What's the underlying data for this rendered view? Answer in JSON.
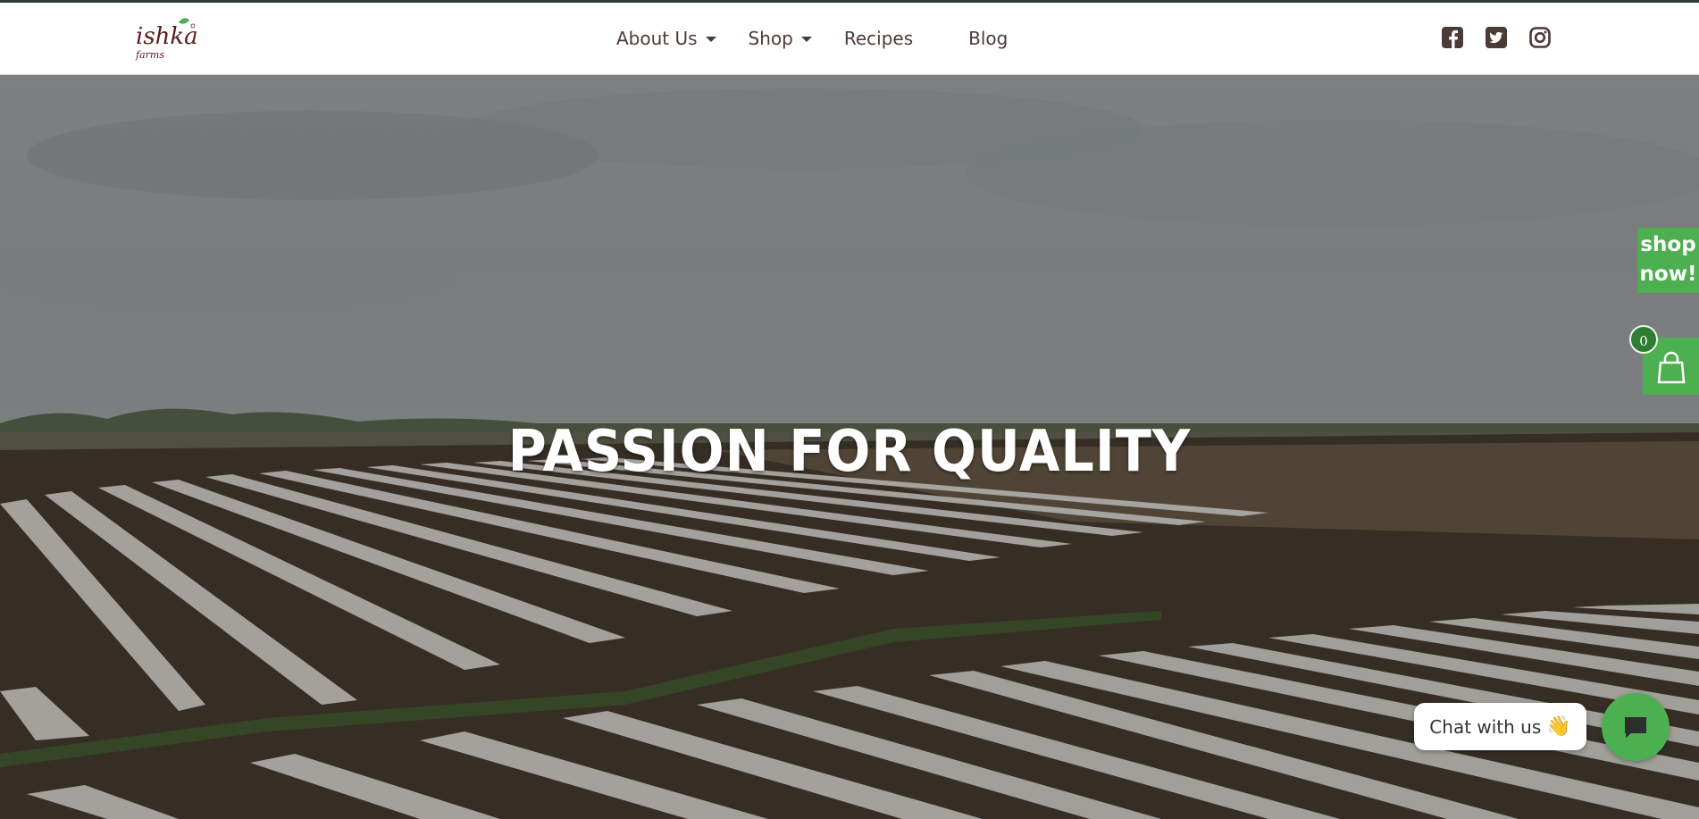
{
  "brand": {
    "logo_word": "ishka",
    "logo_sub": "farms",
    "logo_color": "#5b1a1a",
    "leaf_color": "#4caf50"
  },
  "nav": {
    "items": [
      {
        "label": "About Us",
        "dropdown": true
      },
      {
        "label": "Shop",
        "dropdown": true
      },
      {
        "label": "Recipes",
        "dropdown": false
      },
      {
        "label": "Blog",
        "dropdown": false
      }
    ]
  },
  "social": {
    "icons": [
      "facebook-icon",
      "twitter-icon",
      "instagram-icon"
    ],
    "color": "#4a3b36"
  },
  "hero": {
    "title": "PASSION FOR QUALITY"
  },
  "side": {
    "shop_now_line1": "shop",
    "shop_now_line2": "now!",
    "cart_count": "0",
    "accent": "#4caf50"
  },
  "chat": {
    "label": "Chat with us",
    "emoji": "👋"
  }
}
